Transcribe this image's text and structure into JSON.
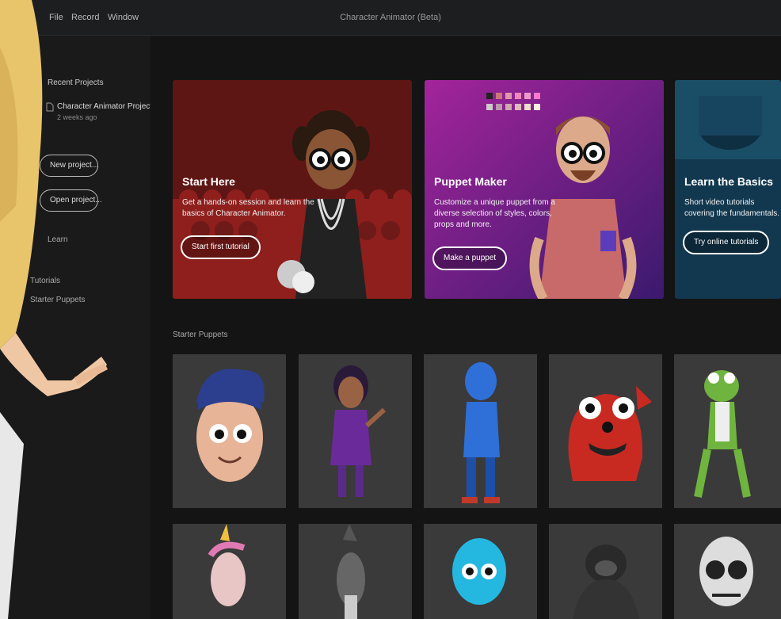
{
  "titlebar": {
    "menu": [
      "File",
      "Record",
      "Window"
    ],
    "title": "Character Animator (Beta)"
  },
  "sidebar": {
    "header": "Recent Projects",
    "project_name": "Character Animator Project",
    "project_sub": "2 weeks ago",
    "button_1": "New project...",
    "button_2": "Open project...",
    "section_2": "Learn",
    "section_3": "Tutorials",
    "section_4": "Starter Puppets"
  },
  "cards": [
    {
      "title": "Start Here",
      "desc": "Get a hands-on session and learn the basics of Character Animator.",
      "button": "Start first tutorial"
    },
    {
      "title": "Puppet Maker",
      "desc": "Customize a unique puppet from a diverse selection of styles, colors, props and more.",
      "button": "Make a puppet"
    },
    {
      "title": "Learn the Basics",
      "desc": "Short video tutorials covering the fundamentals.",
      "button": "Try online tutorials"
    }
  ],
  "section_label": "Starter Puppets",
  "colors": {
    "accent_red": "#8e1f1c",
    "accent_purple": "#7a2a8e",
    "accent_teal": "#1a4e66",
    "tile_bg": "#3a3a3a"
  },
  "icons": {
    "app_logo": "puppet-logo-icon"
  }
}
